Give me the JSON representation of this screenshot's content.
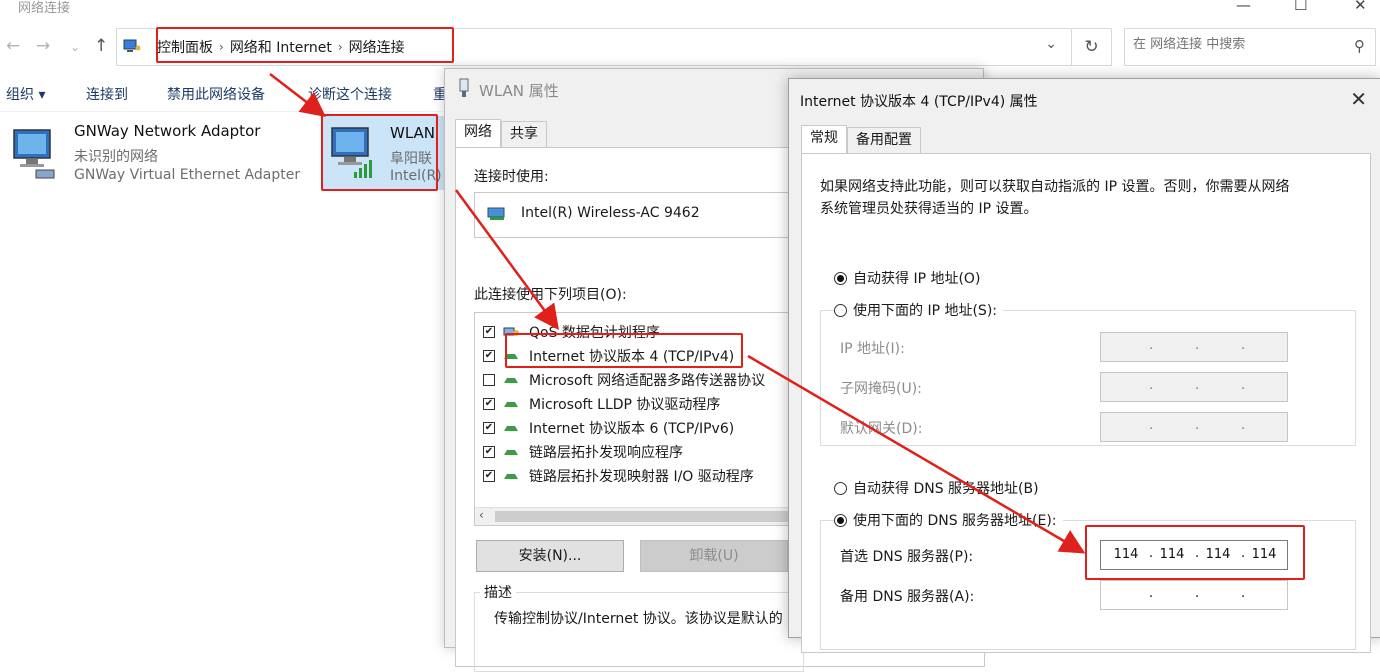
{
  "window": {
    "title": "网络连接"
  },
  "address_bar": {
    "breadcrumbs": [
      "控制面板",
      "网络和 Internet",
      "网络连接"
    ],
    "search_placeholder": "在 网络连接 中搜索"
  },
  "command_bar": {
    "items": [
      "组织 ▾",
      "连接到",
      "禁用此网络设备",
      "诊断这个连接",
      "重"
    ]
  },
  "adapters": [
    {
      "name": "GNWay Network Adaptor",
      "status": "未识别的网络",
      "device": "GNWay Virtual Ethernet Adapter"
    },
    {
      "name": "WLAN",
      "status": "阜阳联",
      "device": "Intel(R)"
    }
  ],
  "wlan_dialog": {
    "title": "WLAN 属性",
    "tabs": [
      "网络",
      "共享"
    ],
    "connect_using_label": "连接时使用:",
    "device": "Intel(R) Wireless-AC 9462",
    "items_label": "此连接使用下列项目(O):",
    "items": [
      {
        "label": "QoS 数据包计划程序",
        "checked": true
      },
      {
        "label": "Internet 协议版本 4 (TCP/IPv4)",
        "checked": true
      },
      {
        "label": "Microsoft 网络适配器多路传送器协议",
        "checked": false
      },
      {
        "label": "Microsoft LLDP 协议驱动程序",
        "checked": true
      },
      {
        "label": "Internet 协议版本 6 (TCP/IPv6)",
        "checked": true
      },
      {
        "label": "链路层拓扑发现响应程序",
        "checked": true
      },
      {
        "label": "链路层拓扑发现映射器 I/O 驱动程序",
        "checked": true
      }
    ],
    "install_button": "安装(N)...",
    "uninstall_button": "卸载(U)",
    "description_title": "描述",
    "description_text": "传输控制协议/Internet 协议。该协议是默认的"
  },
  "ipv4_dialog": {
    "title": "Internet 协议版本 4 (TCP/IPv4) 属性",
    "tabs": [
      "常规",
      "备用配置"
    ],
    "intro_line1": "如果网络支持此功能，则可以获取自动指派的 IP 设置。否则，你需要从网络",
    "intro_line2": "系统管理员处获得适当的 IP 设置。",
    "auto_ip": "自动获得 IP 地址(O)",
    "manual_ip": "使用下面的 IP 地址(S):",
    "ip_address_label": "IP 地址(I):",
    "subnet_label": "子网掩码(U):",
    "gateway_label": "默认网关(D):",
    "auto_dns": "自动获得 DNS 服务器地址(B)",
    "manual_dns": "使用下面的 DNS 服务器地址(E):",
    "preferred_dns_label": "首选 DNS 服务器(P):",
    "preferred_dns": [
      "114",
      "114",
      "114",
      "114"
    ],
    "alternate_dns_label": "备用 DNS 服务器(A):"
  },
  "colors": {
    "annotation": "#e0201a",
    "selection": "#cce4f7"
  }
}
